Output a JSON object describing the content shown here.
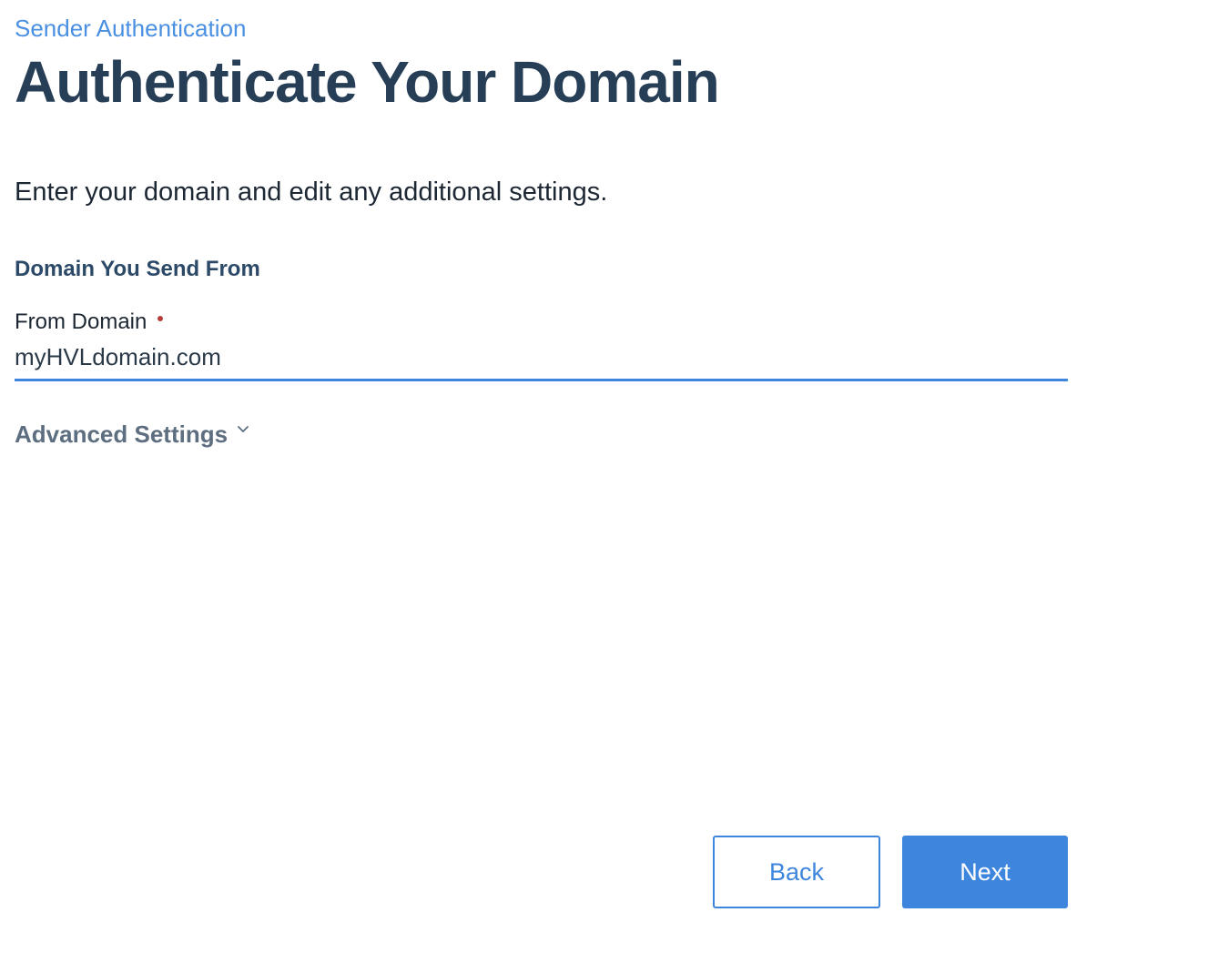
{
  "breadcrumb": {
    "label": "Sender Authentication"
  },
  "header": {
    "title": "Authenticate Your Domain",
    "description": "Enter your domain and edit any additional settings."
  },
  "domain_section": {
    "heading": "Domain You Send From",
    "from_domain": {
      "label": "From Domain",
      "value": "myHVLdomain.com",
      "required": true
    }
  },
  "advanced_settings": {
    "label": "Advanced Settings",
    "icon": "chevron-down-icon"
  },
  "actions": {
    "back_label": "Back",
    "next_label": "Next"
  },
  "colors": {
    "accent": "#3e86dd",
    "link": "#4a90e2",
    "required": "#b73c3c",
    "title": "#263e56"
  }
}
